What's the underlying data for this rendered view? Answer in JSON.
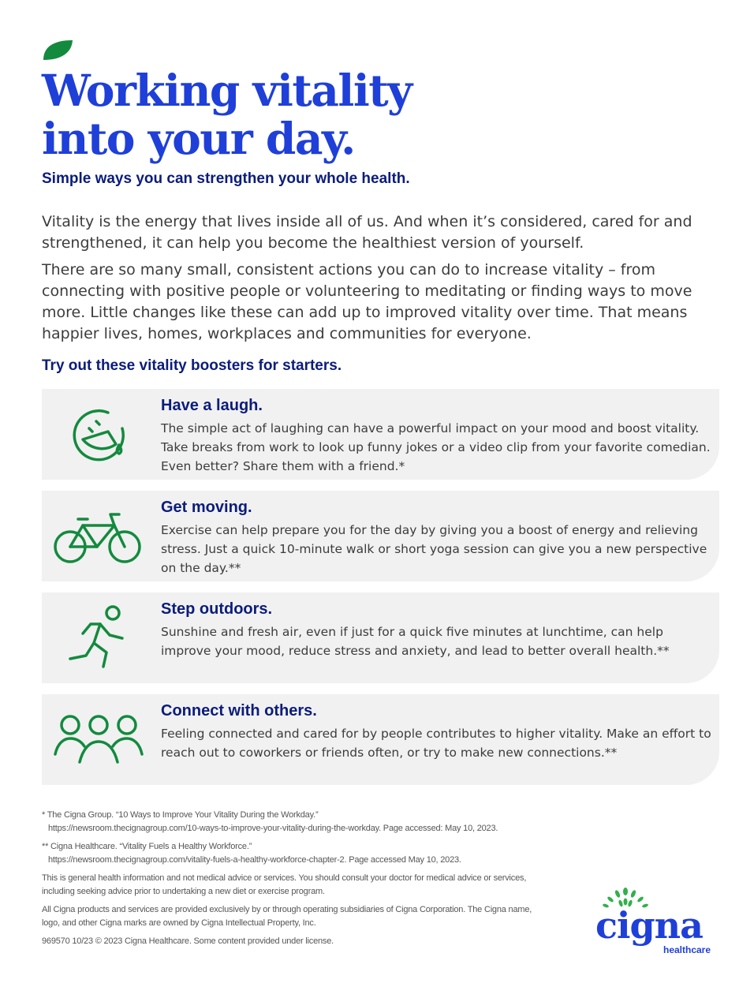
{
  "header": {
    "title_line1": "Working vitality",
    "title_line2": "into your day.",
    "subtitle": "Simple ways you can strengthen your whole health."
  },
  "intro": {
    "paragraph1": "Vitality is the energy that lives inside all of us. And when it’s considered, cared for and strengthened, it can help you become the healthiest version of yourself.",
    "paragraph2": "There are so many small, consistent actions you can do to increase vitality – from connecting with positive people or volunteering to meditating or finding ways to move more. Little changes like these can add up to improved vitality over time. That means happier lives, homes, workplaces and communities for everyone."
  },
  "boosters": {
    "heading": "Try out these vitality boosters for starters.",
    "items": [
      {
        "icon": "laugh-face-icon",
        "title": "Have a laugh.",
        "body": "The simple act of laughing can have a powerful impact on your mood and boost vitality. Take breaks from work to look up funny jokes or a video clip from your favorite comedian. Even better? Share them with a friend.*"
      },
      {
        "icon": "bicycle-icon",
        "title": "Get moving.",
        "body": "Exercise can help prepare you for the day by giving you a boost of energy and relieving stress. Just a quick 10-minute walk or short yoga session can give you a new perspective on the day.**"
      },
      {
        "icon": "runner-icon",
        "title": "Step outdoors.",
        "body": "Sunshine and fresh air, even if just for a quick five minutes at lunchtime, can help improve your mood, reduce stress and anxiety, and lead to better overall health.**"
      },
      {
        "icon": "people-group-icon",
        "title": "Connect with others.",
        "body": "Feeling connected and cared for by people contributes to higher vitality. Make an effort to reach out to coworkers or friends often, or try to make new connections.**"
      }
    ]
  },
  "footnotes": {
    "note1_line1": "* The Cigna Group. “10 Ways to Improve Your Vitality During the Workday.”",
    "note1_line2": "https://newsroom.thecignagroup.com/10-ways-to-improve-your-vitality-during-the-workday. Page accessed: May 10, 2023.",
    "note2_line1": "** Cigna Healthcare. “Vitality Fuels a Healthy Workforce.”",
    "note2_line2": "https://newsroom.thecignagroup.com/vitality-fuels-a-healthy-workforce-chapter-2. Page accessed May 10, 2023.",
    "disclaimer": "This is general health information and not medical advice or services. You should consult your doctor for medical advice or services, including seeking advice prior to undertaking a new diet or exercise program.",
    "legal": "All Cigna products and services are provided exclusively by or through operating subsidiaries of Cigna Corporation. The Cigna name, logo, and other Cigna marks are owned by Cigna Intellectual Property, Inc.",
    "code": "969570  10/23  © 2023 Cigna Healthcare. Some content provided under license."
  },
  "logo": {
    "wordmark": "cigna",
    "subtext": "healthcare"
  },
  "colors": {
    "brand_blue": "#1f3fd9",
    "navy": "#0b1c7a",
    "icon_green": "#138a3e",
    "card_bg": "#f1f1f1"
  }
}
